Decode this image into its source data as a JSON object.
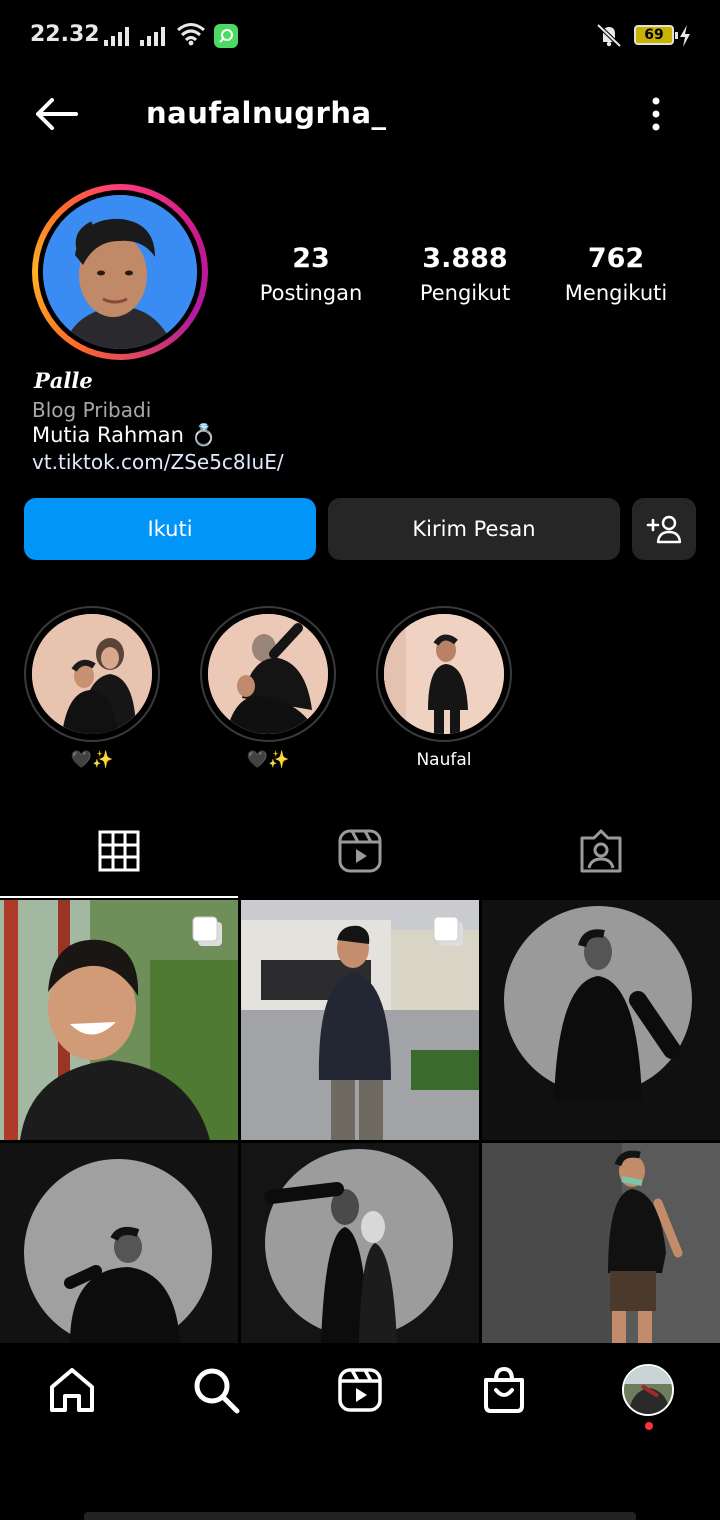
{
  "status_bar": {
    "time": "22.32",
    "battery": "69",
    "icons": [
      "signal-icon",
      "signal-icon",
      "wifi-icon",
      "app-notification-icon",
      "vibrate-mute-icon",
      "battery-icon",
      "charging-icon"
    ]
  },
  "header": {
    "username": "naufalnugrha_",
    "back_icon": "back-arrow-icon",
    "menu_icon": "more-vertical-icon"
  },
  "stats": [
    {
      "value": "23",
      "label": "Postingan"
    },
    {
      "value": "3.888",
      "label": "Pengikut"
    },
    {
      "value": "762",
      "label": "Mengikuti"
    }
  ],
  "bio": {
    "name": "𝑷𝒂𝒍𝒍𝒆",
    "category": "Blog Pribadi",
    "line": "Mutia Rahman 💍",
    "link": "vt.tiktok.com/ZSe5c8IuE/"
  },
  "actions": {
    "follow_label": "Ikuti",
    "message_label": "Kirim Pesan",
    "suggest_icon": "add-person-icon"
  },
  "highlights": [
    {
      "label": "🖤✨"
    },
    {
      "label": "🖤✨"
    },
    {
      "label": "Naufal"
    }
  ],
  "tabs": [
    "grid-icon",
    "reels-icon",
    "tagged-icon"
  ],
  "nav": [
    "home-icon",
    "search-icon",
    "reels-icon",
    "shop-icon",
    "profile-avatar"
  ],
  "colors": {
    "accent": "#0095f6",
    "button_secondary": "#262626",
    "notification_dot": "#ff3040"
  }
}
